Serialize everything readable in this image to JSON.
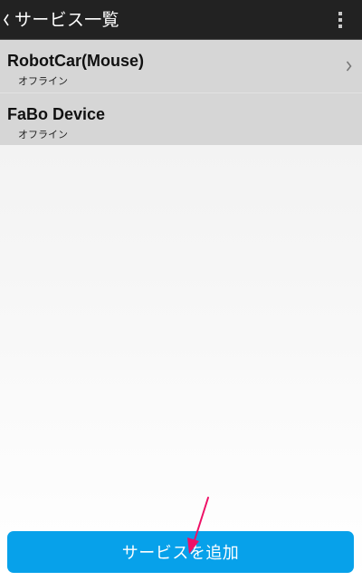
{
  "action_bar": {
    "title": "サービス一覧",
    "back_icon": "chevron-left-icon",
    "overflow_icon": "more-vertical-icon"
  },
  "services": [
    {
      "name": "RobotCar(Mouse)",
      "status": "オフライン",
      "has_chevron": true
    },
    {
      "name": "FaBo Device",
      "status": "オフライン",
      "has_chevron": false
    }
  ],
  "add_button": {
    "label": "サービスを追加"
  },
  "annotation": {
    "icon": "pointer-arrow-icon",
    "color": "#ee1166"
  },
  "colors": {
    "action_bar": "#222222",
    "list_item": "#d6d6d6",
    "accent_button": "#07a1ea"
  }
}
